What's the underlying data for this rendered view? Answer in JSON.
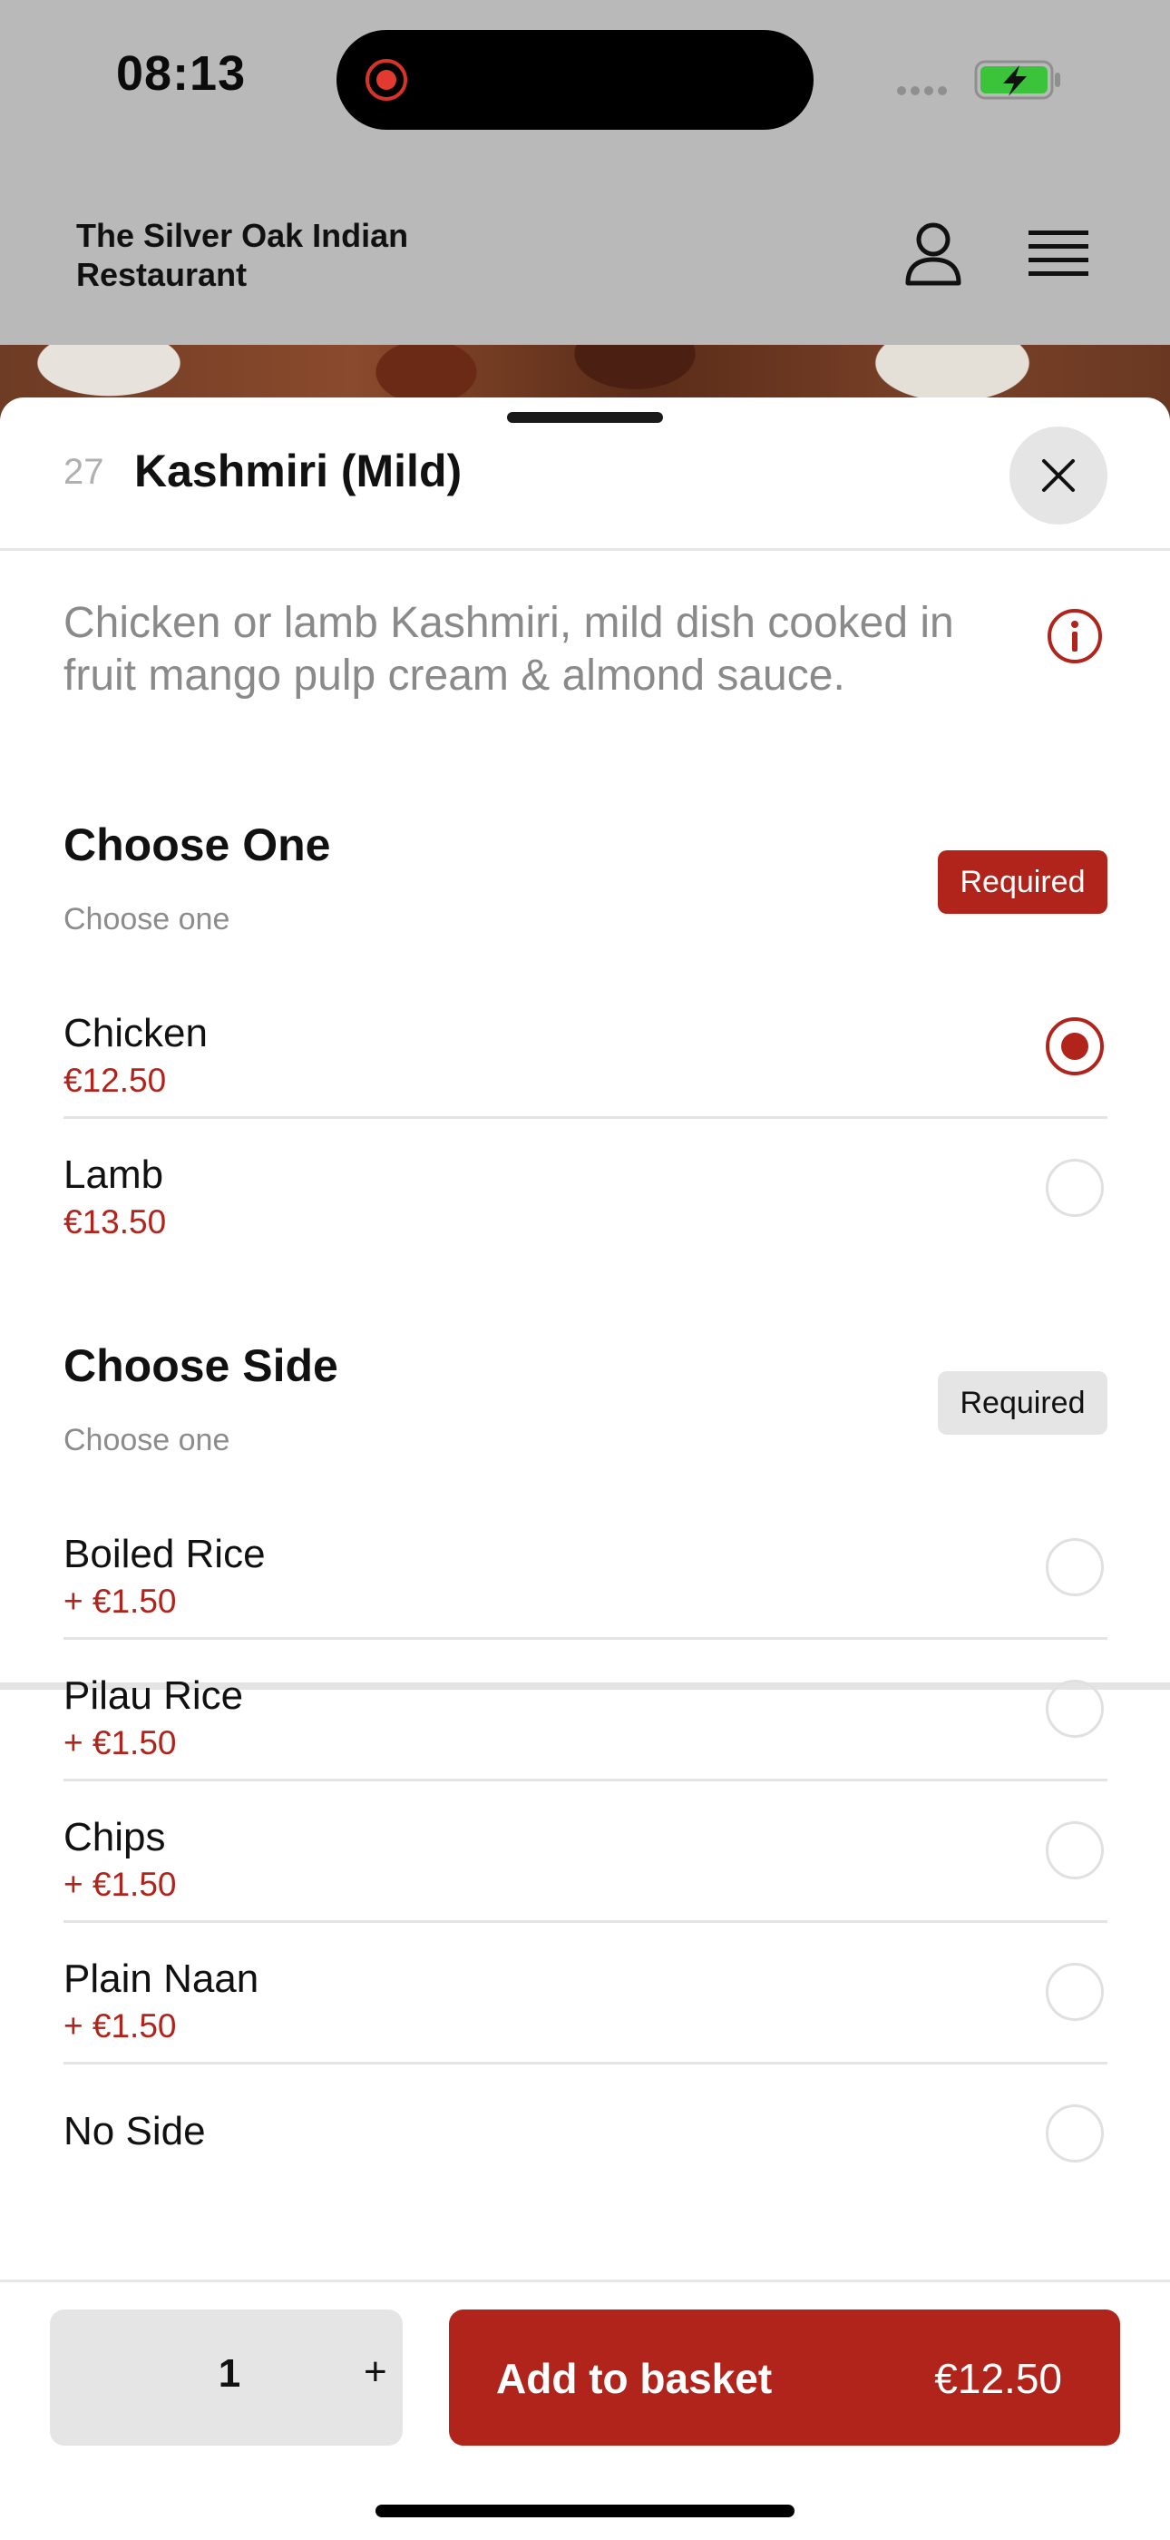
{
  "status_bar": {
    "time": "08:13"
  },
  "site": {
    "restaurant_name": "The Silver Oak Indian Restaurant"
  },
  "icons": {
    "recording": "recording-dot-icon",
    "signal": "signal-dots-icon",
    "battery": "battery-charging-icon",
    "account": "user-icon",
    "menu": "hamburger-menu-icon",
    "close": "close-icon",
    "info": "info-icon"
  },
  "item": {
    "number": "27",
    "title": "Kashmiri (Mild)",
    "description": "Chicken or lamb Kashmiri, mild dish cooked in fruit mango pulp cream & almond sauce."
  },
  "groups": [
    {
      "title": "Choose One",
      "subtitle": "Choose one",
      "badge": "Required",
      "options": [
        {
          "name": "Chicken",
          "price": "€12.50",
          "selected": true
        },
        {
          "name": "Lamb",
          "price": "€13.50",
          "selected": false
        }
      ]
    },
    {
      "title": "Choose Side",
      "subtitle": "Choose one",
      "badge": "Required",
      "options": [
        {
          "name": "Boiled Rice",
          "price": "+ €1.50",
          "selected": false
        },
        {
          "name": "Pilau Rice",
          "price": "+ €1.50",
          "selected": false
        },
        {
          "name": "Chips",
          "price": "+ €1.50",
          "selected": false
        },
        {
          "name": "Plain Naan",
          "price": "+ €1.50",
          "selected": false
        },
        {
          "name": "No Side",
          "price": "",
          "selected": false
        }
      ]
    }
  ],
  "footer": {
    "quantity": "1",
    "plus_symbol": "+",
    "add_label": "Add to basket",
    "total": "€12.50"
  },
  "colors": {
    "accent": "#b0241b",
    "backdrop": "#b9b9b9",
    "muted_text": "#8a8a8a",
    "divider": "#e4e4e4"
  }
}
